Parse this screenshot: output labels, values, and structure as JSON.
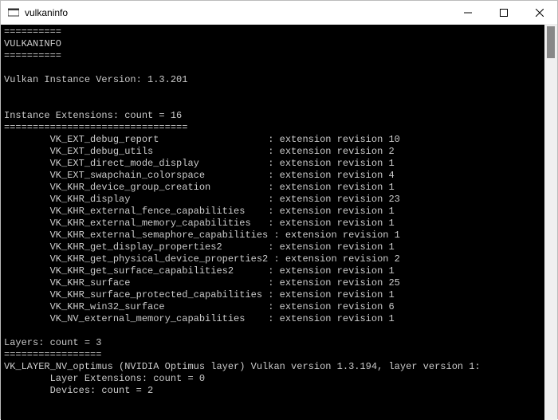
{
  "titlebar": {
    "title": "vulkaninfo"
  },
  "term": {
    "sep1": "==========",
    "heading": "VULKANINFO",
    "sep2": "==========",
    "version_line": "Vulkan Instance Version: 1.3.201",
    "inst_ext_header": "Instance Extensions: count = 16",
    "inst_ext_sep": "================================",
    "extensions": [
      {
        "name": "VK_EXT_debug_report",
        "rev": "10"
      },
      {
        "name": "VK_EXT_debug_utils",
        "rev": "2"
      },
      {
        "name": "VK_EXT_direct_mode_display",
        "rev": "1"
      },
      {
        "name": "VK_EXT_swapchain_colorspace",
        "rev": "4"
      },
      {
        "name": "VK_KHR_device_group_creation",
        "rev": "1"
      },
      {
        "name": "VK_KHR_display",
        "rev": "23"
      },
      {
        "name": "VK_KHR_external_fence_capabilities",
        "rev": "1"
      },
      {
        "name": "VK_KHR_external_memory_capabilities",
        "rev": "1"
      },
      {
        "name": "VK_KHR_external_semaphore_capabilities",
        "rev": "1"
      },
      {
        "name": "VK_KHR_get_display_properties2",
        "rev": "1"
      },
      {
        "name": "VK_KHR_get_physical_device_properties2",
        "rev": "2"
      },
      {
        "name": "VK_KHR_get_surface_capabilities2",
        "rev": "1"
      },
      {
        "name": "VK_KHR_surface",
        "rev": "25"
      },
      {
        "name": "VK_KHR_surface_protected_capabilities",
        "rev": "1"
      },
      {
        "name": "VK_KHR_win32_surface",
        "rev": "6"
      },
      {
        "name": "VK_NV_external_memory_capabilities",
        "rev": "1"
      }
    ],
    "layers_header": "Layers: count = 3",
    "layers_sep": "=================",
    "layer_line": "VK_LAYER_NV_optimus (NVIDIA Optimus layer) Vulkan version 1.3.194, layer version 1:",
    "layer_ext": "Layer Extensions: count = 0",
    "layer_dev": "Devices: count = 2",
    "ext_label": "extension revision"
  }
}
